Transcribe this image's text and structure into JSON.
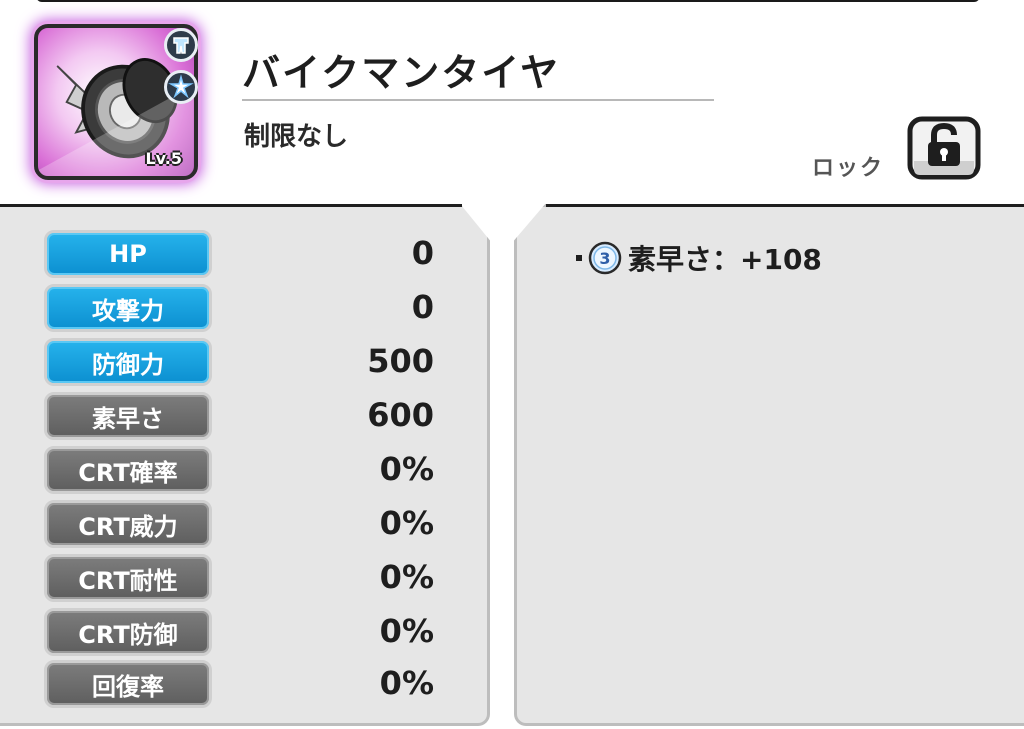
{
  "item": {
    "name": "バイクマンタイヤ",
    "restriction": "制限なし",
    "level": "Lv.5",
    "frame_color": "#c55fe0"
  },
  "lock": {
    "label": "ロック",
    "icon": "unlocked-padlock-icon"
  },
  "stats": [
    {
      "label": "HP",
      "value": "0",
      "style": "blue"
    },
    {
      "label": "攻撃力",
      "value": "0",
      "style": "blue"
    },
    {
      "label": "防御力",
      "value": "500",
      "style": "blue"
    },
    {
      "label": "素早さ",
      "value": "600",
      "style": "gray"
    },
    {
      "label": "CRT確率",
      "value": "0%",
      "style": "gray"
    },
    {
      "label": "CRT威力",
      "value": "0%",
      "style": "gray"
    },
    {
      "label": "CRT耐性",
      "value": "0%",
      "style": "gray"
    },
    {
      "label": "CRT防御",
      "value": "0%",
      "style": "gray"
    },
    {
      "label": "回復率",
      "value": "0%",
      "style": "gray"
    }
  ],
  "effects": [
    {
      "tier": "3",
      "text": "素早さ：+108"
    }
  ],
  "colors": {
    "stat_blue": "#0c8fd0",
    "stat_gray": "#5e5e5e",
    "panel_bg": "#e6e6e6"
  }
}
